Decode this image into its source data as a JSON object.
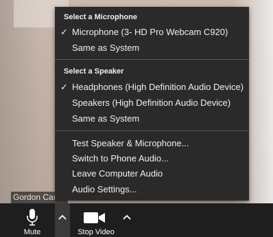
{
  "participant": {
    "name": "Gordon Carter"
  },
  "audio_menu": {
    "microphone_header": "Select a Microphone",
    "microphones": [
      {
        "label": "Microphone (3- HD Pro Webcam C920)",
        "selected": true
      },
      {
        "label": "Same as System",
        "selected": false
      }
    ],
    "speaker_header": "Select a Speaker",
    "speakers": [
      {
        "label": "Headphones (High Definition Audio Device)",
        "selected": true
      },
      {
        "label": "Speakers (High Definition Audio Device)",
        "selected": false
      },
      {
        "label": "Same as System",
        "selected": false
      }
    ],
    "actions": [
      "Test Speaker & Microphone...",
      "Switch to Phone Audio...",
      "Leave Computer Audio",
      "Audio Settings..."
    ],
    "check_glyph": "✓"
  },
  "toolbar": {
    "mute_label": "Mute",
    "video_label": "Stop Video"
  }
}
